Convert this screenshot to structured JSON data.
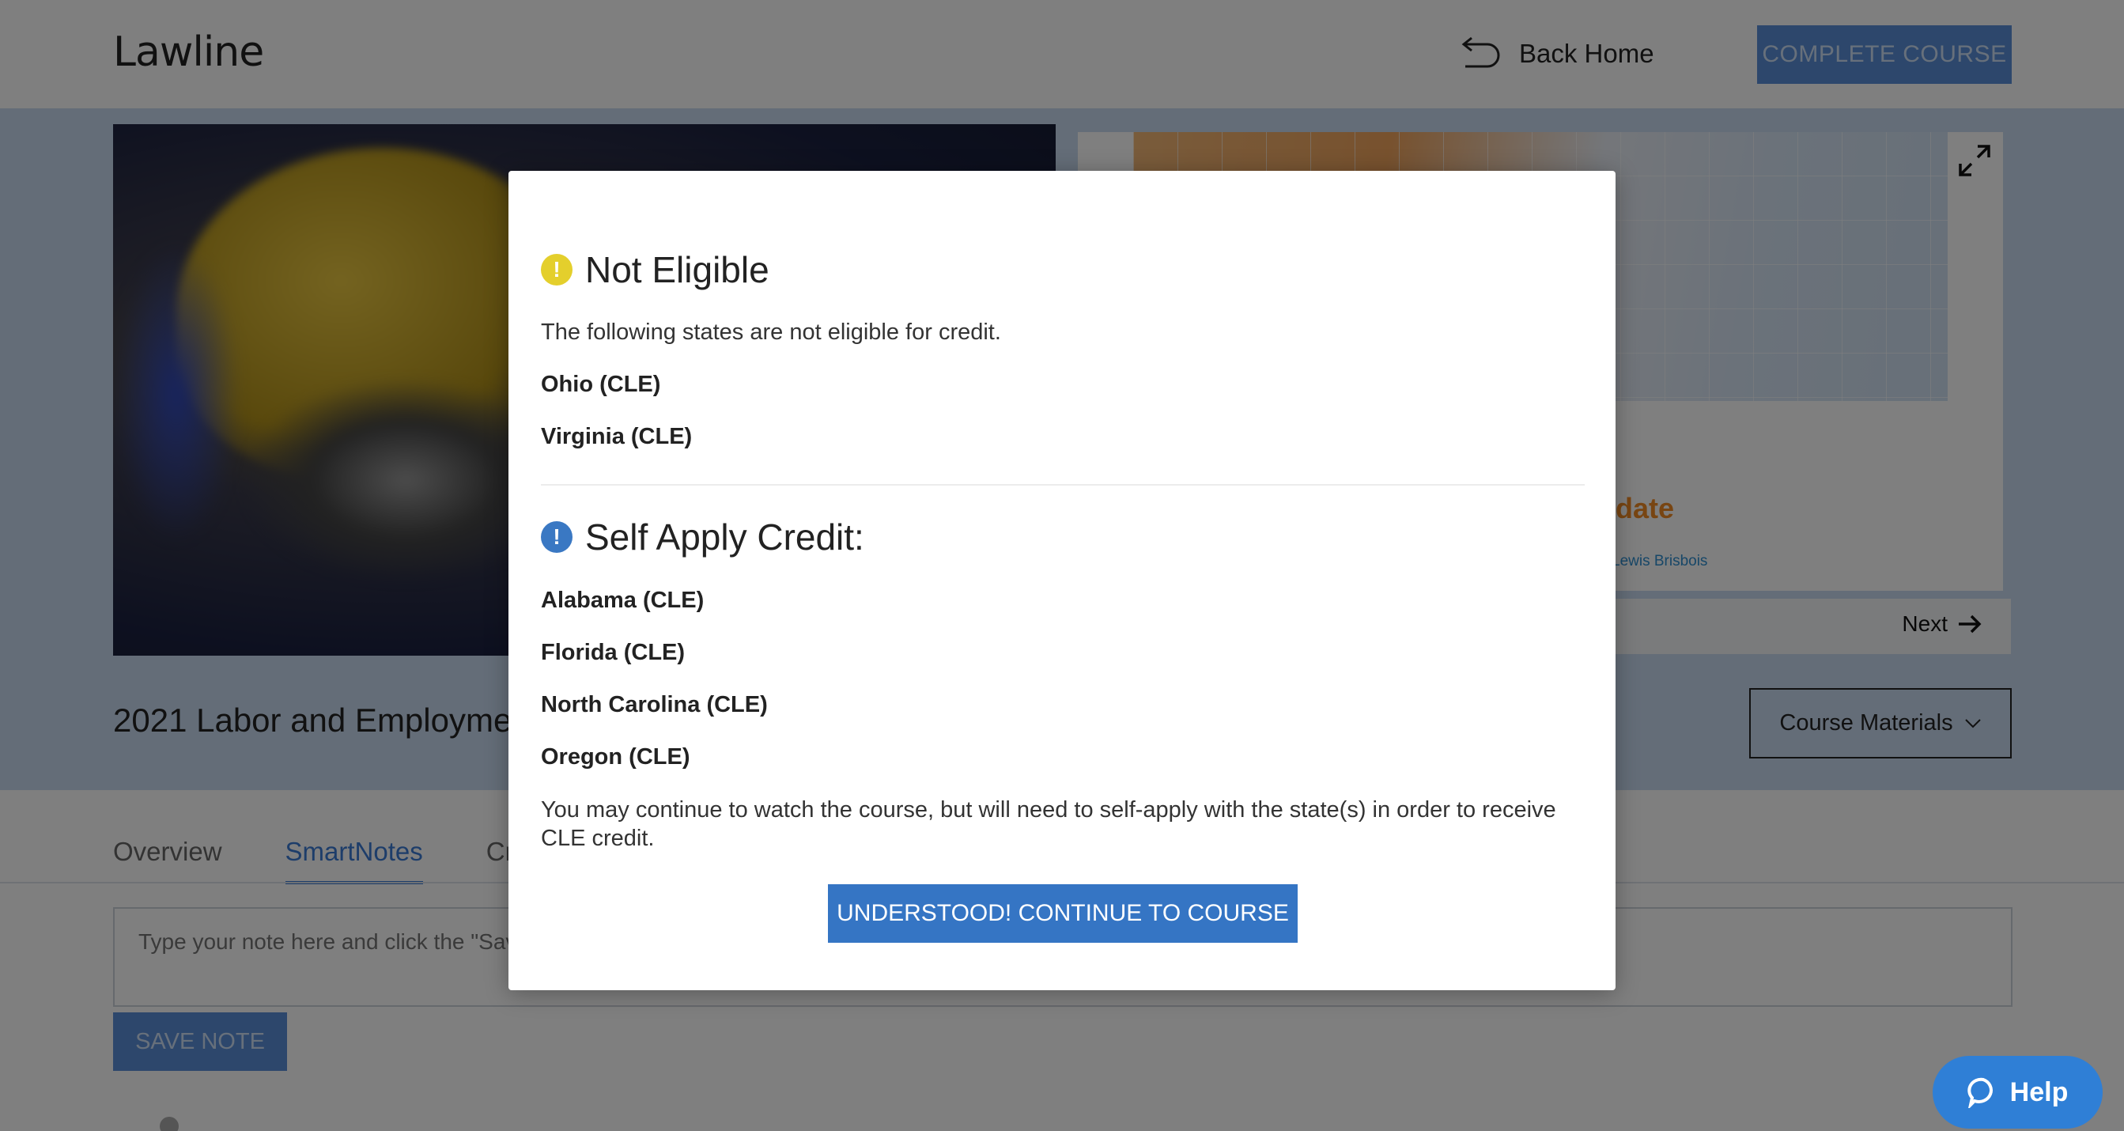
{
  "header": {
    "logo": "Lawline",
    "back_home": "Back Home",
    "complete_course": "COMPLETE COURSE"
  },
  "hero": {
    "slide_title_fragment": "date",
    "slide_sub_fragment": "Lewis Brisbois",
    "next_label": "Next",
    "course_title": "2021 Labor and Employmen",
    "course_materials": "Course Materials"
  },
  "tabs": {
    "items": [
      "Overview",
      "SmartNotes",
      "Cr"
    ],
    "active": "SmartNotes"
  },
  "notes": {
    "placeholder": "Type your note here and click the \"Save",
    "save_label": "SAVE NOTE"
  },
  "modal": {
    "not_eligible": {
      "title": "Not Eligible",
      "intro": "The following states are not eligible for credit.",
      "states": [
        "Ohio (CLE)",
        "Virginia (CLE)"
      ]
    },
    "self_apply": {
      "title": "Self Apply Credit:",
      "states": [
        "Alabama (CLE)",
        "Florida (CLE)",
        "North Carolina (CLE)",
        "Oregon (CLE)"
      ]
    },
    "note": "You may continue to watch the course, but will need to self-apply with the state(s) in order to receive CLE credit.",
    "continue_label": "UNDERSTOOD! CONTINUE TO COURSE"
  },
  "help": {
    "label": "Help"
  },
  "colors": {
    "accent": "#3575c4",
    "warning": "#e4cf2c",
    "info": "#3a78c3"
  }
}
